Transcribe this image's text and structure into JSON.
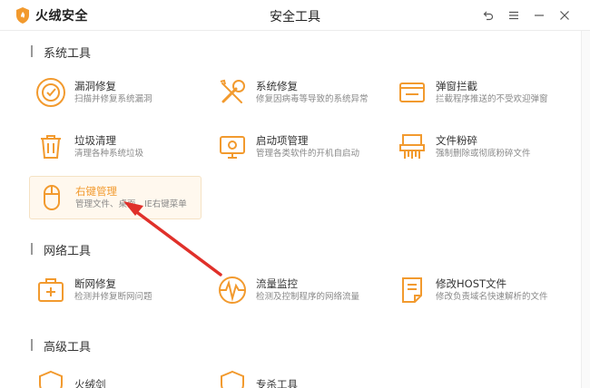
{
  "app": {
    "name": "火绒安全",
    "window_title": "安全工具"
  },
  "colors": {
    "accent": "#f29a2e",
    "annotation_arrow": "#e0302a"
  },
  "sections": [
    {
      "title": "系统工具",
      "tools": [
        {
          "name": "漏洞修复",
          "desc": "扫描并修复系统漏洞",
          "icon": "vulnerability-repair-icon"
        },
        {
          "name": "系统修复",
          "desc": "修复因病毒等导致的系统异常",
          "icon": "wrench-icon"
        },
        {
          "name": "弹窗拦截",
          "desc": "拦截程序推送的不受欢迎弹窗",
          "icon": "popup-block-icon"
        },
        {
          "name": "垃圾清理",
          "desc": "清理各种系统垃圾",
          "icon": "trash-icon"
        },
        {
          "name": "启动项管理",
          "desc": "管理各类软件的开机自启动",
          "icon": "startup-monitor-icon"
        },
        {
          "name": "文件粉碎",
          "desc": "强制删除或彻底粉碎文件",
          "icon": "shredder-icon"
        },
        {
          "name": "右键管理",
          "desc": "管理文件、桌面、IE右键菜单",
          "icon": "mouse-icon"
        }
      ]
    },
    {
      "title": "网络工具",
      "tools": [
        {
          "name": "断网修复",
          "desc": "检测并修复断网问题",
          "icon": "first-aid-kit-icon"
        },
        {
          "name": "流量监控",
          "desc": "检测及控制程序的网络流量",
          "icon": "traffic-monitor-icon"
        },
        {
          "name": "修改HOST文件",
          "desc": "修改负责域名快速解析的文件",
          "icon": "host-file-icon"
        }
      ]
    },
    {
      "title": "高级工具",
      "tools": [
        {
          "name": "火绒剑",
          "desc": "",
          "icon": "shield-icon"
        },
        {
          "name": "专杀工具",
          "desc": "",
          "icon": "shield-icon"
        }
      ]
    }
  ]
}
